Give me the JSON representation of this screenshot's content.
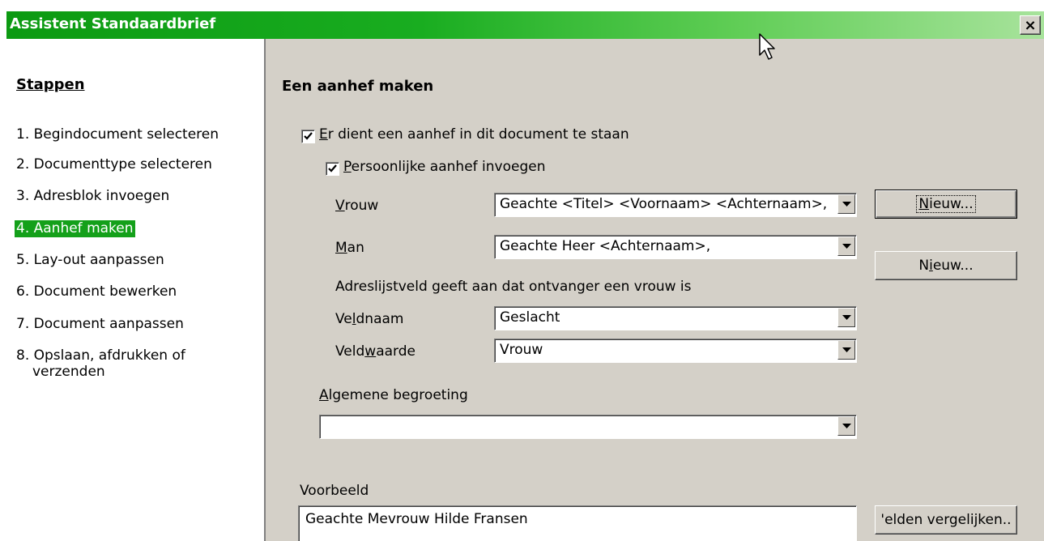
{
  "window": {
    "title": "Assistent Standaardbrief",
    "close_label": "×"
  },
  "sidebar": {
    "title": "Stappen",
    "steps": [
      "1. Begindocument selecteren",
      "2. Documenttype selecteren",
      "3. Adresblok invoegen",
      "4. Aanhef maken",
      "5. Lay-out aanpassen",
      "6. Document bewerken",
      "7. Document aanpassen",
      "8. Opslaan, afdrukken of",
      "verzenden"
    ],
    "active_index": 3
  },
  "main": {
    "heading": "Een aanhef maken",
    "chk_aanhef": {
      "label_pre": "",
      "label_mnemonic": "E",
      "label_rest": "r dient een aanhef in dit document te staan",
      "checked": true
    },
    "chk_persoonlijk": {
      "label_mnemonic": "P",
      "label_rest": "ersoonlijke aanhef invoegen",
      "checked": true
    },
    "vrouw": {
      "label_mnemonic": "V",
      "label_rest": "rouw",
      "value": "Geachte <Titel> <Voornaam> <Achternaam>,",
      "button_mnemonic": "N",
      "button_rest": "ieuw..."
    },
    "man": {
      "label_mnemonic": "M",
      "label_rest": "an",
      "value": "Geachte Heer <Achternaam>,",
      "button_pre": "N",
      "button_mnemonic": "i",
      "button_rest": "euw..."
    },
    "adreslijst_note": "Adreslijstveld geeft aan dat ontvanger een vrouw is",
    "veldnaam": {
      "label_pre": "Ve",
      "label_mnemonic": "l",
      "label_rest": "dnaam",
      "value": "Geslacht"
    },
    "veldwaarde": {
      "label_pre": "Veld",
      "label_mnemonic": "w",
      "label_rest": "aarde",
      "value": "Vrouw"
    },
    "algemene": {
      "label_mnemonic": "A",
      "label_rest": "lgemene begroeting",
      "value": ""
    },
    "voorbeeld": {
      "label": "Voorbeeld",
      "value": "Geachte Mevrouw Hilde Fransen",
      "button": "'elden vergelijken.."
    }
  }
}
